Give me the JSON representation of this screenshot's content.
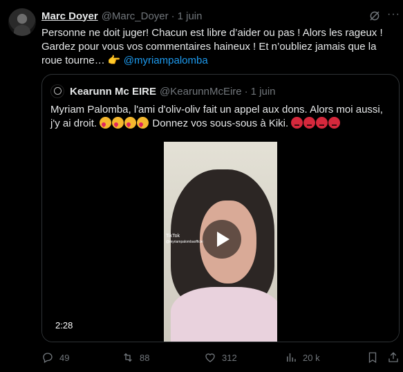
{
  "tweet": {
    "author_name": "Marc Doyer",
    "author_handle": "@Marc_Doyer",
    "separator": "·",
    "time": "1 juin",
    "text": "Personne ne doit juger! Chacun est libre d’aider ou pas ! Alors les rageux ! Gardez pour vous vos commentaires haineux ! Et n’oubliez jamais que la roue tourne… 👉",
    "mention": "@myriampalomba",
    "more_icon": "···"
  },
  "quote": {
    "author_name": "Kearunn Mc EIRE",
    "author_handle": "@KearunnMcEire",
    "separator": "·",
    "time": "1 juin",
    "text_before": "Myriam Palomba, l'ami d'oliv-oliv fait un appel aux dons. Alors moi aussi, j'y ai droit.",
    "text_after": "Donnez vos sous-sous à Kiki.",
    "emoji_love": "🥰",
    "emoji_angry": "😡",
    "video": {
      "duration": "2:28",
      "watermark_brand": "TikTok",
      "watermark_handle": "@myriampalombaofficiel"
    }
  },
  "actions": {
    "replies": "49",
    "retweets": "88",
    "likes": "312",
    "views": "20 k"
  },
  "colors": {
    "background": "#000000",
    "text": "#e7e9ea",
    "muted": "#71767b",
    "link": "#1d9bf0",
    "border": "#2f3336"
  }
}
